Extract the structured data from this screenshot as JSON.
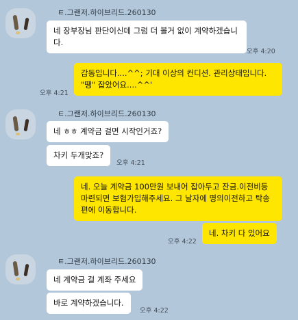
{
  "groups": [
    {
      "sender": "ㅌ.그랜저.하이브리드.260130",
      "messages": [
        {
          "text": "네 장부장님 판단이신데 그럼 더 볼거 없이 계약하겠습니다.",
          "time": "오후 4:20"
        }
      ]
    },
    {
      "sender": "ㅌ.그랜저.하이브리드.260130",
      "messages": [
        {
          "text": "네 ㅎㅎ 계약금 걸면 시작인거죠?",
          "time": ""
        },
        {
          "text": "차키 두개맞죠?",
          "time": "오후 4:21"
        }
      ]
    },
    {
      "sender": "ㅌ.그랜저.하이브리드.260130",
      "messages": [
        {
          "text": "네 계약금 걸 계좌 주세요",
          "time": ""
        },
        {
          "text": "바로 계약하겠습니다.",
          "time": "오후 4:22"
        }
      ]
    }
  ],
  "outgoing": [
    {
      "text": "감동입니다....^^;                    기대 이상의 컨디션. 관리상태입니다.   \"땡\" 잡았어요....^^'",
      "time": "오후 4:21"
    },
    {
      "text": "네.  오늘 계약금 100만원 보내어 잡아두고      잔금.이전비등 마련되면  보험가입해주세요.   그 날자에 명의이전하고  탁송편에 이동합니다.",
      "time": ""
    },
    {
      "text": "네.  차키 다 있어요",
      "time": "오후 4:22"
    }
  ],
  "colors": {
    "background": "#b2c7da",
    "incoming_bubble": "#ffffff",
    "outgoing_bubble": "#ffe600"
  }
}
